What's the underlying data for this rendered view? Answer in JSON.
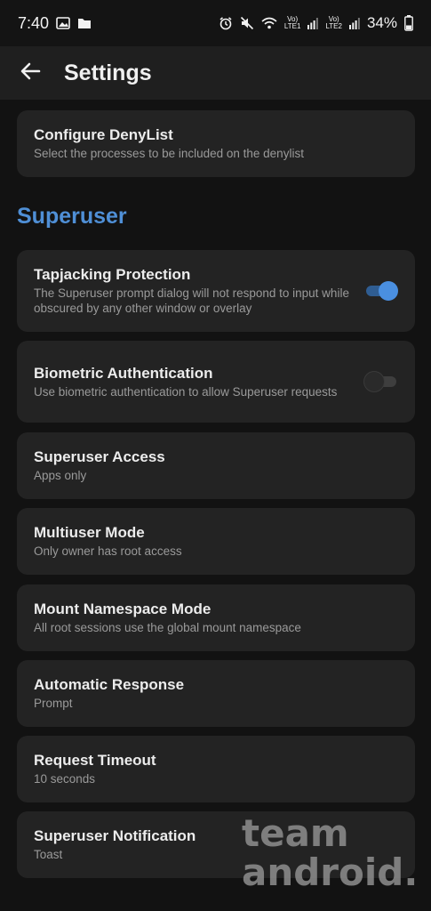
{
  "status_bar": {
    "time": "7:40",
    "sim1_label_top": "Vo)",
    "sim1_label_bottom": "LTE1",
    "sim2_label_top": "Vo)",
    "sim2_label_bottom": "LTE2",
    "battery": "34%",
    "icons": [
      "image-icon",
      "folder-icon",
      "alarm-icon",
      "mute-icon",
      "wifi-icon",
      "signal-icon",
      "battery-icon"
    ]
  },
  "app_bar": {
    "title": "Settings"
  },
  "items": [
    {
      "title": "Configure DenyList",
      "subtitle": "Select the processes to be included on the denylist"
    }
  ],
  "superuser": {
    "section_title": "Superuser",
    "items": [
      {
        "title": "Tapjacking Protection",
        "subtitle": "The Superuser prompt dialog will not respond to input while obscured by any other window or overlay",
        "toggle": true
      },
      {
        "title": "Biometric Authentication",
        "subtitle": "Use biometric authentication to allow Superuser requests",
        "toggle": false
      },
      {
        "title": "Superuser Access",
        "subtitle": "Apps only"
      },
      {
        "title": "Multiuser Mode",
        "subtitle": "Only owner has root access"
      },
      {
        "title": "Mount Namespace Mode",
        "subtitle": "All root sessions use the global mount namespace"
      },
      {
        "title": "Automatic Response",
        "subtitle": "Prompt"
      },
      {
        "title": "Request Timeout",
        "subtitle": "10 seconds"
      },
      {
        "title": "Superuser Notification",
        "subtitle": "Toast"
      }
    ]
  },
  "watermark": {
    "line1": "team",
    "line2": "android."
  },
  "colors": {
    "accent": "#4f8fd6",
    "background": "#121212",
    "card": "#232323"
  }
}
